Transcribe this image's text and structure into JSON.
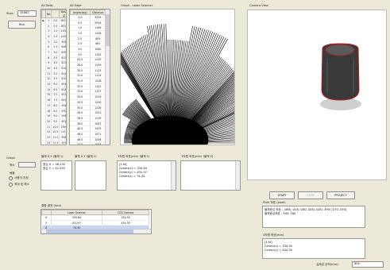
{
  "left": {
    "start_label": "Start",
    "start_value": "35863",
    "run_button": "Run",
    "graph_group_label": "Graph",
    "axis_label": "축소",
    "unit_label": "배율",
    "radio_manual": "사용자 지정",
    "radio_auto": "최대 및 최소"
  },
  "all_data": {
    "title": "All Data",
    "columns": [
      "",
      "No",
      "Data 값"
    ],
    "rows": [
      [
        "▶",
        "1",
        "0.0",
        "3837"
      ],
      [
        "",
        "2",
        "0.5",
        "3834"
      ],
      [
        "",
        "3",
        "1.0",
        "1308"
      ],
      [
        "",
        "4",
        "1.5",
        "1190"
      ],
      [
        "",
        "5",
        "2.0",
        "909"
      ],
      [
        "",
        "6",
        "2.5",
        "848"
      ],
      [
        "",
        "7",
        "3.0",
        "839"
      ],
      [
        "",
        "8",
        "3.5",
        "823"
      ],
      [
        "",
        "9",
        "4.0",
        "823"
      ],
      [
        "",
        "10",
        "4.5",
        "814"
      ],
      [
        "",
        "11",
        "5.0",
        "814"
      ],
      [
        "",
        "12",
        "5.5",
        "812"
      ],
      [
        "",
        "13",
        "6.0",
        "814"
      ],
      [
        "",
        "14",
        "6.5",
        "814"
      ],
      [
        "",
        "15",
        "7.0",
        "812"
      ],
      [
        "",
        "16",
        "7.5",
        "843"
      ],
      [
        "",
        "17",
        "8.0",
        "904"
      ],
      [
        "",
        "18",
        "8.5",
        "930"
      ],
      [
        "",
        "19",
        "9.0",
        "936"
      ],
      [
        "",
        "20",
        "9.5",
        "951"
      ],
      [
        "",
        "21",
        "10.0",
        "1396"
      ],
      [
        "",
        "22",
        "10.5",
        "1151"
      ],
      [
        "",
        "23",
        "11.0",
        "994"
      ],
      [
        "",
        "24",
        "11.5",
        "957"
      ],
      [
        "",
        "25",
        "12.0",
        "998"
      ],
      [
        "",
        "26",
        "12.5",
        "973"
      ],
      [
        "",
        "27",
        "13.0",
        "954"
      ],
      [
        "",
        "28",
        "13.5",
        "949"
      ],
      [
        "",
        "29",
        "14.0",
        "940"
      ],
      [
        "*",
        "",
        "",
        ""
      ]
    ]
  },
  "all_edge": {
    "title": "All Edge",
    "columns": [
      "Angle(deg)",
      "Distance"
    ],
    "rows": [
      [
        "-0.5",
        "3559"
      ],
      [
        "0.5",
        "3554"
      ],
      [
        "1.0",
        "1189"
      ],
      [
        "1.5",
        "1108"
      ],
      [
        "2.0",
        "809"
      ],
      [
        "2.5",
        "861"
      ],
      [
        "3.0",
        "1080"
      ],
      [
        "3.5",
        "1155"
      ],
      [
        "25.5",
        "1135"
      ],
      [
        "26.0",
        "1139"
      ],
      [
        "30.0",
        "1123"
      ],
      [
        "31.0",
        "1124"
      ],
      [
        "31.5",
        "1128"
      ],
      [
        "32.0",
        "1141"
      ],
      [
        "33.0",
        "1157"
      ],
      [
        "34.0",
        "1229"
      ],
      [
        "34.5",
        "1250"
      ],
      [
        "35.0",
        "1226"
      ],
      [
        "36.0",
        "1201"
      ],
      [
        "36.5",
        "1139"
      ],
      [
        "38.0",
        "1087"
      ],
      [
        "42.5",
        "1005"
      ],
      [
        "46.0",
        "1071"
      ],
      [
        "46.5",
        "1046"
      ],
      [
        "47.0",
        "1093"
      ],
      [
        "49.0",
        "1150"
      ],
      [
        "50.0",
        "1070"
      ],
      [
        "54.0",
        "1027"
      ],
      [
        "58.5",
        "1138"
      ]
    ]
  },
  "graph": {
    "title": "Graph - Laser Scanner",
    "fan_color": "#000000"
  },
  "camera": {
    "title": "Camera View",
    "object_color": "#3a3a3a",
    "outline_color": "#b02020"
  },
  "panels": {
    "info1": {
      "title": "물체 X,Y (물체 1)",
      "lines": [
        "중심 X = 46.232",
        "중심 Y = 32.030"
      ]
    },
    "info2": {
      "title": "물체 X,Y (물체 2)",
      "lines": []
    },
    "info3": {
      "title": "3차원 좌표(mm) (물체 1)",
      "lines": [
        "[1:st]",
        "Center(x) = 330.84",
        "Center(y) = 431.97",
        "Center(z) = 74.35"
      ]
    },
    "info4": {
      "title": "3차원 좌표(mm) (물체 2)",
      "lines": []
    }
  },
  "result": {
    "title": "결합 결과 (mm)",
    "columns": [
      "",
      "Laser Scanner",
      "CCD Camera"
    ],
    "rows": [
      [
        "X",
        "330.84",
        "334.30"
      ],
      [
        "Y",
        "431.97",
        "434.30"
      ],
      [
        "Z",
        "74.35",
        ""
      ]
    ]
  },
  "buttons": {
    "start": "START",
    "stop": "STOP",
    "project": "PROJECT"
  },
  "pixel_panel": {
    "title": "Pixel 좌표 (pixel)",
    "lines": [
      "물체중심 좌표 : (468, 149) (280, 285)-(430, 390) (270, 295)",
      "물체중심좌표 : 345, 180"
    ]
  },
  "coord_panel": {
    "title": "3차원 좌표(mm)",
    "lines": [
      "[1:st]",
      "Center(x) = 334.30",
      "Center(y) = 434.30"
    ]
  },
  "bottom": {
    "depth_label": "실제값 입력(mm):",
    "depth_value": "850"
  }
}
